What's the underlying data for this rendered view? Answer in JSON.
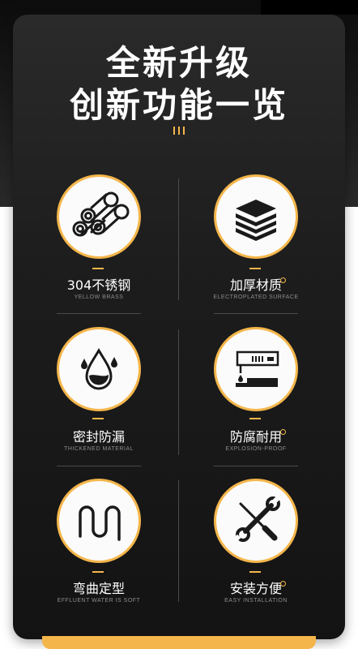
{
  "title": {
    "line1": "全新升级",
    "line2": "创新功能一览"
  },
  "features": [
    {
      "label": "304不锈钢",
      "sub": "YELLOW BRASS",
      "icon": "pipes-icon"
    },
    {
      "label": "加厚材质",
      "sub": "ELECTROPLATED SURFACE",
      "icon": "layers-icon"
    },
    {
      "label": "密封防漏",
      "sub": "THICKENED MATERIAL",
      "icon": "water-drop-icon"
    },
    {
      "label": "防腐耐用",
      "sub": "EXPLOSION-PROOF",
      "icon": "corrosion-test-icon"
    },
    {
      "label": "弯曲定型",
      "sub": "EFFLUENT WATER IS SOFT",
      "icon": "bent-hose-icon"
    },
    {
      "label": "安装方便",
      "sub": "EASY INSTALLATION",
      "icon": "tools-icon"
    }
  ],
  "colors": {
    "accent": "#f4b64b",
    "card": "#1d1d1d",
    "icon": "#1a1a1a"
  }
}
